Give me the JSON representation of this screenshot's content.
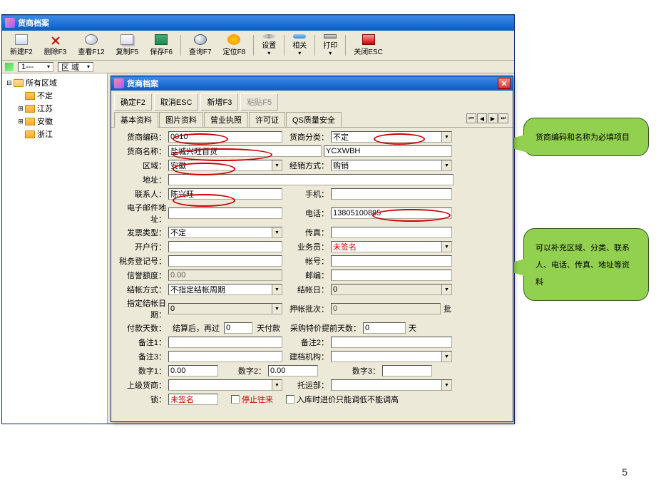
{
  "titlebar": {
    "title": "货商档案"
  },
  "toolbar": {
    "new": "新建F2",
    "delete": "删除F3",
    "view": "查看F12",
    "copy": "复制F5",
    "save": "保存F6",
    "query": "查询F7",
    "locate": "定位F8",
    "settings": "设置",
    "related": "相关",
    "print": "打印",
    "close": "关闭ESC"
  },
  "filter": {
    "f1": "1---",
    "f2": "区 域"
  },
  "tree": {
    "root": "所有区域",
    "items": [
      "不定",
      "江苏",
      "安徽",
      "浙江"
    ]
  },
  "subwin": {
    "title": "货商档案"
  },
  "sub_buttons": {
    "ok": "确定F2",
    "cancel": "取消ESC",
    "add": "新增F3",
    "paste": "粘贴F5"
  },
  "tabs": {
    "t0": "基本资料",
    "t1": "图片资料",
    "t2": "营业执照",
    "t3": "许可证",
    "t4": "QS质量安全"
  },
  "labels": {
    "code": "货商编码：",
    "category": "货商分类：",
    "name": "货商名称：",
    "region": "区域：",
    "sales_mode": "经销方式：",
    "address": "地址：",
    "contact": "联系人：",
    "mobile": "手机：",
    "email": "电子邮件地址：",
    "phone": "电话：",
    "invoice": "发票类型：",
    "fax": "传真：",
    "bank": "开户行：",
    "salesman": "业务员：",
    "tax_reg": "税务登记号：",
    "account": "帐号：",
    "credit": "信誉额度：",
    "postcode": "邮编：",
    "settle_mode": "结帐方式：",
    "settle_day": "结帐日：",
    "settle_date": "指定结帐日期：",
    "deposit_batch": "押帐批次：",
    "pay_days": "付款天数：",
    "settle_after": "结算后，再过",
    "days_pay": "天付款",
    "purchase_alert": "采购特价提前天数：",
    "days": "天",
    "remark1": "备注1：",
    "remark2": "备注2：",
    "remark3": "备注3：",
    "build_org": "建档机构：",
    "num1": "数字1：",
    "num2": "数字2：",
    "num3": "数字3：",
    "parent": "上级货商：",
    "consign": "托运部：",
    "lock": "锁：",
    "stop": "停止往来",
    "no_adjust": "入库时进价只能调低不能调高",
    "batch_unit": "批"
  },
  "values": {
    "code": "0010",
    "category": "不定",
    "name": "盐城兴旺百货",
    "name_py": "YCXWBH",
    "region": "安徽",
    "sales_mode": "购销",
    "contact": "陈兴旺",
    "phone": "13805100885",
    "invoice": "不定",
    "salesman": "未签名",
    "credit": "0.00",
    "settle_mode": "不指定结帐周期",
    "settle_day": "0",
    "settle_date": "0",
    "deposit_batch": "0",
    "pay_days": "0",
    "purchase_alert": "0",
    "num1": "0.00",
    "num2": "0.00",
    "lock": "未签名"
  },
  "callout1": "货商编码和名称为必填项目",
  "callout2": "可以补充区域、分类、联系人、电话、传真、地址等资料",
  "page_number": "5"
}
